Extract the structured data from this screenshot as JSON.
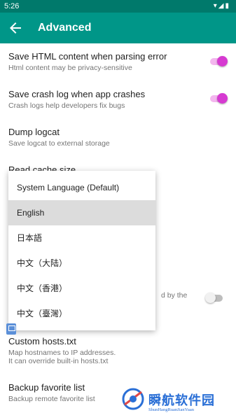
{
  "status_bar": {
    "time": "5:26",
    "icons": [
      "wifi-icon",
      "signal-icon",
      "battery-icon"
    ]
  },
  "app_bar": {
    "title": "Advanced",
    "back_icon": "arrow-back-icon"
  },
  "settings": [
    {
      "title": "Save HTML content when parsing error",
      "summary": "Html content may be privacy-sensitive",
      "switch": "on"
    },
    {
      "title": "Save crash log when app crashes",
      "summary": "Crash logs help developers fix bugs",
      "switch": "on"
    },
    {
      "title": "Dump logcat",
      "summary": "Save logcat to external storage"
    },
    {
      "title": "Read cache size",
      "summary": ""
    },
    {
      "partial_summary": "d by the",
      "switch": "off"
    },
    {
      "title": "Custom hosts.txt",
      "summary": "Map hostnames to IP addresses.\nIt can override built-in hosts.txt"
    },
    {
      "title": "Backup favorite list",
      "summary": "Backup remote favorite list"
    }
  ],
  "language_menu": {
    "options": [
      "System Language (Default)",
      "English",
      "日本語",
      "中文（大陆）",
      "中文（香港）",
      "中文（臺灣）"
    ],
    "selected": "English"
  },
  "watermark": {
    "text": "瞬航软件园",
    "subtext": "ShunHangRuanJianYuan"
  },
  "colors": {
    "status_bar": "#00796b",
    "app_bar": "#009688",
    "switch_on": "#d63ad1"
  }
}
